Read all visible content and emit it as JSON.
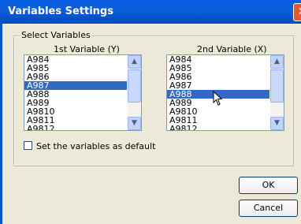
{
  "window": {
    "title": "Variables Settings",
    "close_icon": "close-icon"
  },
  "group": {
    "label": "Select Variables"
  },
  "list_y": {
    "header": "1st Variable (Y)",
    "items": [
      "A984",
      "A985",
      "A986",
      "A987",
      "A988",
      "A989",
      "A9810",
      "A9811",
      "A9812"
    ],
    "selected": "A987"
  },
  "list_x": {
    "header": "2nd Variable (X)",
    "items": [
      "A984",
      "A985",
      "A986",
      "A987",
      "A988",
      "A989",
      "A9810",
      "A9811",
      "A9812"
    ],
    "selected": "A988"
  },
  "default_checkbox": {
    "label": "Set the variables as default",
    "checked": false
  },
  "buttons": {
    "ok": "OK",
    "cancel": "Cancel"
  },
  "colors": {
    "selection": "#316ac5",
    "titlebar": "#0a5ee4"
  }
}
